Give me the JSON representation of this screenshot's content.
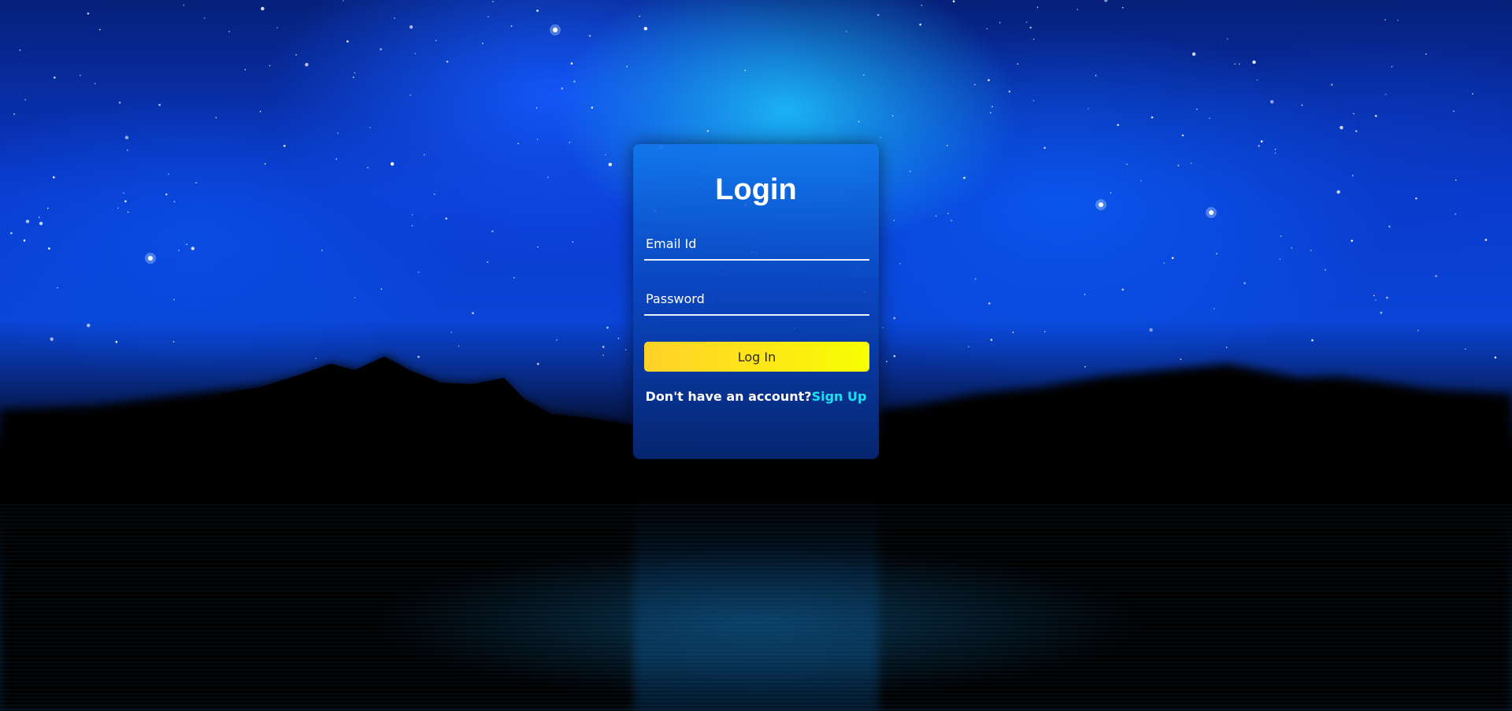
{
  "login": {
    "title": "Login",
    "email_placeholder": "Email Id",
    "password_placeholder": "Password",
    "submit_label": "Log In",
    "signup_prompt": "Don't have an account?",
    "signup_link": "Sign Up"
  },
  "colors": {
    "card_top": "#1276eb",
    "card_bottom": "#06287a",
    "button_gradient_start": "#ffd12a",
    "button_gradient_end": "#f7ff00",
    "signup_link": "#19e3f5",
    "text": "#ffffff"
  }
}
